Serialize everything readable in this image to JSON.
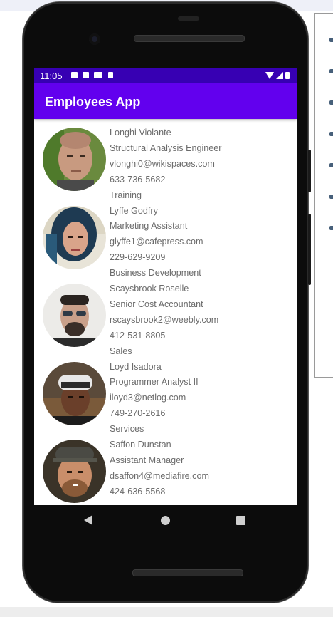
{
  "status_bar": {
    "time": "11:05"
  },
  "app_bar": {
    "title": "Employees App"
  },
  "employees": [
    {
      "name": "Longhi Violante",
      "title": "Structural Analysis Engineer",
      "email": "vlonghi0@wikispaces.com",
      "phone": "633-736-5682",
      "department": "Training"
    },
    {
      "name": "Lyffe Godfry",
      "title": "Marketing Assistant",
      "email": "glyffe1@cafepress.com",
      "phone": "229-629-9209",
      "department": "Business Development"
    },
    {
      "name": "Scaysbrook Roselle",
      "title": "Senior Cost Accountant",
      "email": "rscaysbrook2@weebly.com",
      "phone": "412-531-8805",
      "department": "Sales"
    },
    {
      "name": "Loyd Isadora",
      "title": "Programmer Analyst II",
      "email": "iloyd3@netlog.com",
      "phone": "749-270-2616",
      "department": "Services"
    },
    {
      "name": "Saffon Dunstan",
      "title": "Assistant Manager",
      "email": "dsaffon4@mediafire.com",
      "phone": "424-636-5568"
    }
  ],
  "colors": {
    "status_bar": "#3700b3",
    "app_bar": "#6200ee",
    "text": "#6b6b6b"
  }
}
